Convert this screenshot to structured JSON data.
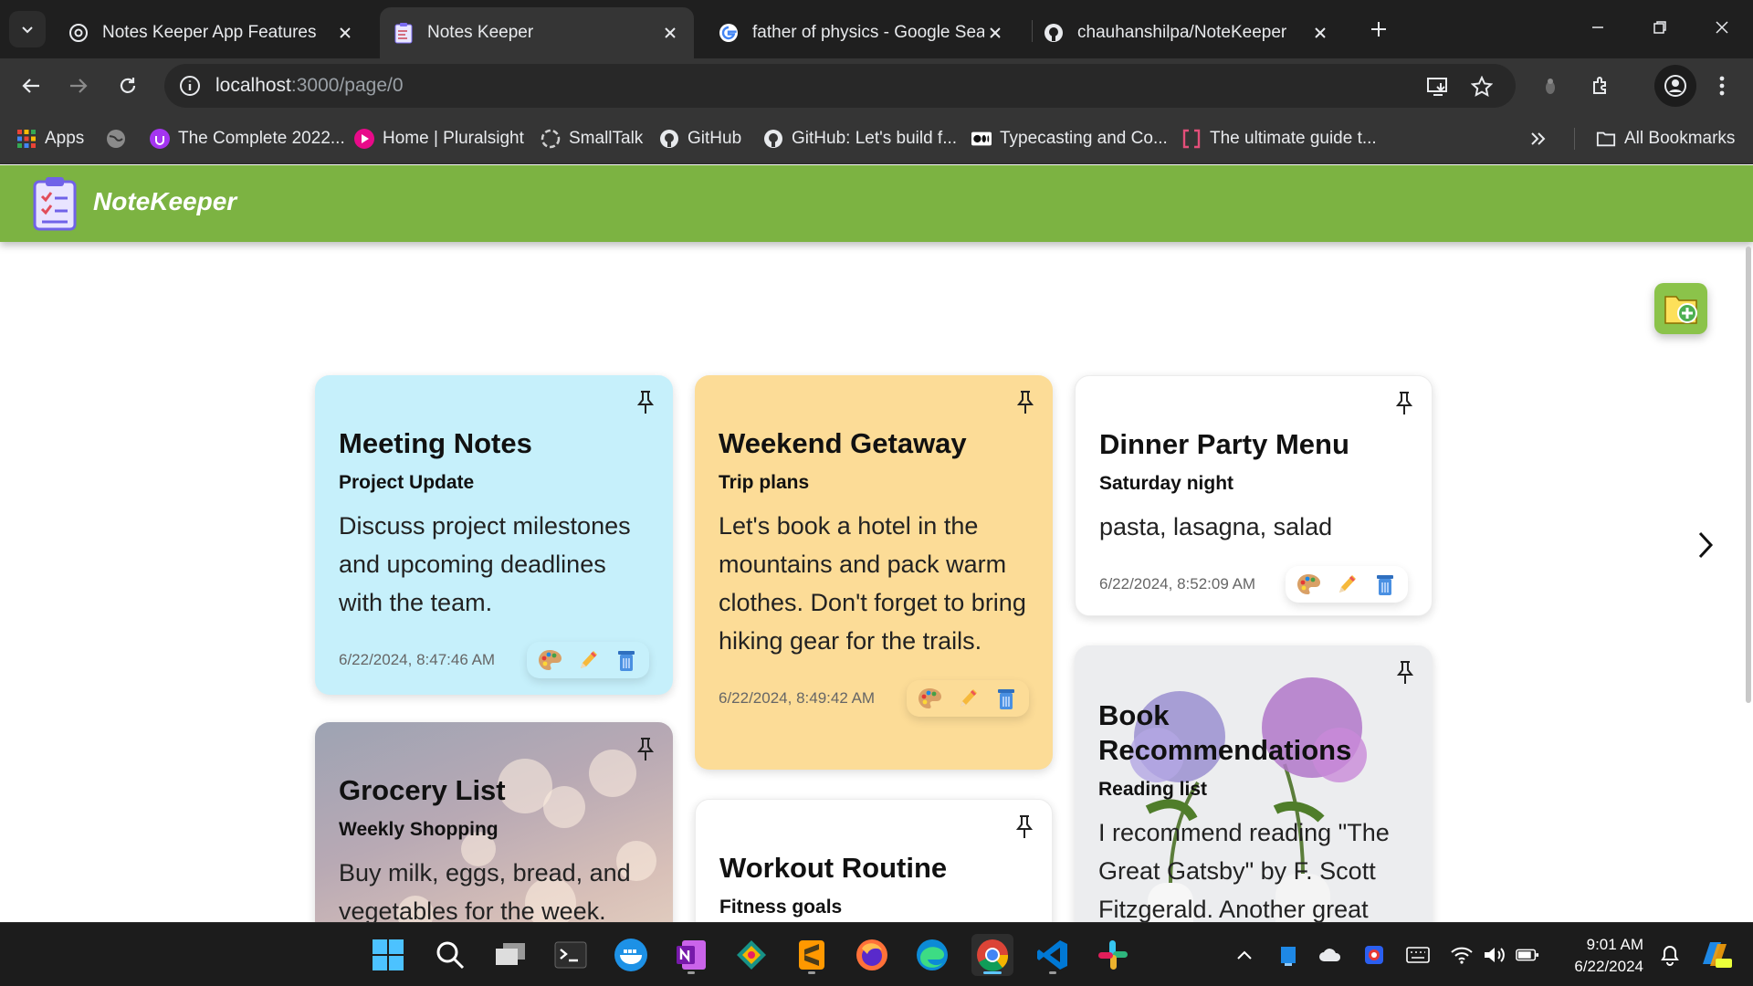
{
  "browser": {
    "tabs": [
      {
        "title": "Notes Keeper App Features",
        "active": false,
        "favicon": "chatgpt-icon"
      },
      {
        "title": "Notes Keeper",
        "active": true,
        "favicon": "notekeeper-favicon"
      },
      {
        "title": "father of physics - Google Searc",
        "active": false,
        "favicon": "google-icon"
      },
      {
        "title": "chauhanshilpa/NoteKeeper",
        "active": false,
        "favicon": "github-icon"
      }
    ],
    "url_host": "localhost",
    "url_path": ":3000/page/0",
    "bookmarks": [
      {
        "label": "Apps",
        "icon": "apps-grid-icon"
      },
      {
        "label": "",
        "icon": "globe-icon"
      },
      {
        "label": "The Complete 2022...",
        "icon": "udemy-icon"
      },
      {
        "label": "Home | Pluralsight",
        "icon": "pluralsight-icon"
      },
      {
        "label": "SmallTalk",
        "icon": "smalltalk-icon"
      },
      {
        "label": "GitHub",
        "icon": "github-icon"
      },
      {
        "label": "GitHub: Let's build f...",
        "icon": "github-icon"
      },
      {
        "label": "Typecasting and Co...",
        "icon": "medium-icon"
      },
      {
        "label": "The ultimate guide t...",
        "icon": "bracket-icon"
      }
    ],
    "all_bookmarks_label": "All Bookmarks"
  },
  "app": {
    "name": "NoteKeeper",
    "accent_color": "#7cb342"
  },
  "notes": [
    {
      "title": "Meeting Notes",
      "tagline": "Project Update",
      "body": "Discuss project milestones and upcoming deadlines with the team.",
      "date": "6/22/2024, 8:47:46 AM",
      "color": "#c6f0fb"
    },
    {
      "title": "Weekend Getaway",
      "tagline": "Trip plans",
      "body": "Let's book a hotel in the mountains and pack warm clothes. Don't forget to bring hiking gear for the trails.",
      "date": "6/22/2024, 8:49:42 AM",
      "color": "#fcdc97"
    },
    {
      "title": "Dinner Party Menu",
      "tagline": "Saturday night",
      "body": "pasta, lasagna, salad",
      "date": "6/22/2024, 8:52:09 AM",
      "color": "#ffffff"
    },
    {
      "title": "Grocery List",
      "tagline": "Weekly Shopping",
      "body": "Buy milk, eggs, bread, and vegetables for the week.",
      "date": "",
      "background": "bokeh-image"
    },
    {
      "title": "Workout Routine",
      "tagline": "Fitness goals",
      "body": "",
      "date": "",
      "color": "#ffffff"
    },
    {
      "title": "Book Recommendations",
      "tagline": "Reading list",
      "body": "I recommend reading \"The Great Gatsby\" by F. Scott Fitzgerald. Another great",
      "date": "",
      "background": "hydrangea-flowers-image"
    }
  ],
  "taskbar": {
    "time": "9:01 AM",
    "date": "6/22/2024",
    "apps": [
      "windows-start-icon",
      "search-icon",
      "task-view-icon",
      "terminal-icon",
      "docker-icon",
      "onenote-icon",
      "gitkraken-icon",
      "sublime-text-icon",
      "firefox-icon",
      "edge-icon",
      "chrome-icon",
      "vscode-icon",
      "slack-icon"
    ]
  }
}
